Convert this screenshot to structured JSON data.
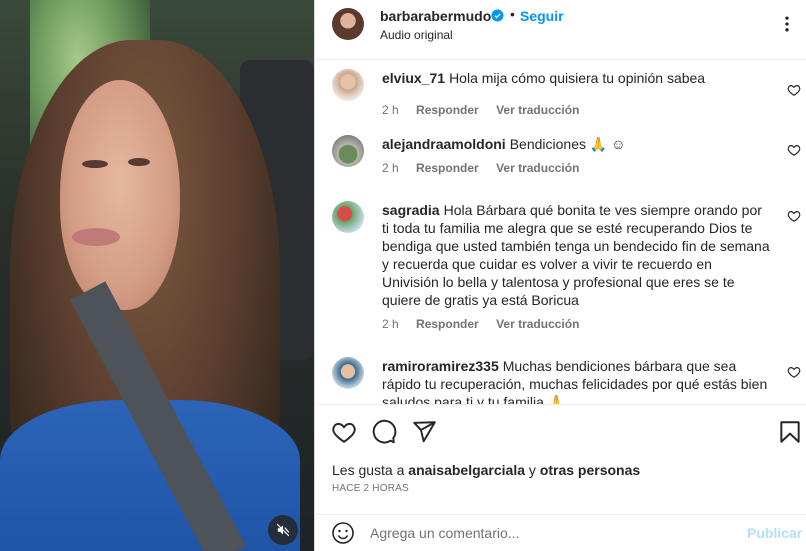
{
  "post": {
    "username": "barbarabermudo",
    "separator": "•",
    "follow_label": "Seguir",
    "subtitle": "Audio original"
  },
  "comments": [
    {
      "username": "elviux_71",
      "text": "Hola mija cómo quisiera tu opinión sabea",
      "time": "2 h",
      "reply_label": "Responder",
      "translate_label": "Ver traducción"
    },
    {
      "username": "alejandraamoldoni",
      "text": "Bendiciones 🙏 ☺",
      "time": "2 h",
      "reply_label": "Responder",
      "translate_label": "Ver traducción"
    },
    {
      "username": "sagradia",
      "text": "Hola Bárbara qué bonita te ves siempre orando por ti toda tu familia me alegra que se esté recuperando Dios te bendiga que usted también tenga un bendecido fin de semana y recuerda que cuidar es volver a vivir te recuerdo en Univisión lo bella y talentosa y profesional que eres se te quiere de gratis ya está Boricua",
      "time": "2 h",
      "reply_label": "Responder",
      "translate_label": "Ver traducción"
    },
    {
      "username": "ramiroramirez335",
      "text": "Muchas bendiciones bárbara que sea rápido tu recuperación, muchas felicidades por qué estás bien saludos para ti y tu familia 🙏"
    }
  ],
  "likes": {
    "prefix": "Les gusta a",
    "user": "anaisabelgarciala",
    "connector": "y",
    "others": "otras personas"
  },
  "timestamp": "HACE 2 HORAS",
  "composer": {
    "placeholder": "Agrega un comentario...",
    "publish_label": "Publicar"
  },
  "colors": {
    "accent": "#0095f6",
    "publish_disabled": "#b2dffc",
    "muted_text": "#737373",
    "text": "#262626"
  },
  "icons": [
    "verified-badge-icon",
    "more-options-icon",
    "heart-icon",
    "comment-icon",
    "share-icon",
    "bookmark-icon",
    "emoji-icon",
    "mute-icon"
  ]
}
